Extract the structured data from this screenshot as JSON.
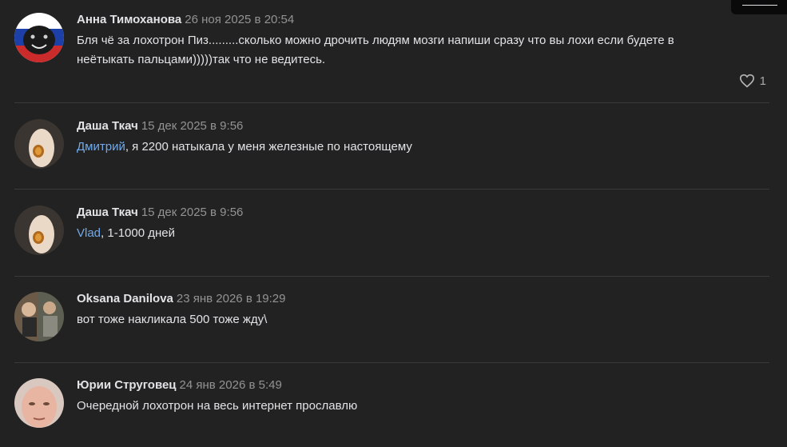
{
  "comments": [
    {
      "author": "Анна Тимоханова",
      "date": "26 ноя 2025 в 20:54",
      "text_line1": "Бля чё за лохотрон Пиз.........сколько можно дрочить людям мозги напиши сразу что вы лохи если будете в",
      "text_line2": "неётыкать пальцами)))))так что не ведитесь.",
      "likes": "1"
    },
    {
      "author": "Даша Ткач",
      "date": "15 дек 2025 в 9:56",
      "mention": "Дмитрий",
      "text": ", я 2200 натыкала у меня железные по настоящему"
    },
    {
      "author": "Даша Ткач",
      "date": "15 дек 2025 в 9:56",
      "mention": "Vlad",
      "text": ", 1-1000 дней"
    },
    {
      "author": "Oksana Danilova",
      "date": "23 янв 2026 в 19:29",
      "text": "вот тоже накликала 500 тоже жду\\"
    },
    {
      "author": "Юрии Струговец",
      "date": "24 янв 2026 в 5:49",
      "text": "Очередной лохотрон на весь интернет прославлю"
    }
  ],
  "icons": {
    "like": "heart-outline-icon",
    "corner": "menu-icon"
  },
  "colors": {
    "background": "#222222",
    "text": "#e1e3e6",
    "muted": "#939393",
    "link": "#71aaeb",
    "divider": "#3a3a3a"
  }
}
